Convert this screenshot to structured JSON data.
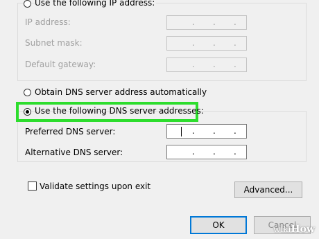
{
  "ip_section": {
    "radio_label": "Use the following IP address:",
    "fields": [
      {
        "label": "IP address:",
        "value": ". . ."
      },
      {
        "label": "Subnet mask:",
        "value": ". . ."
      },
      {
        "label": "Default gateway:",
        "value": ". . ."
      }
    ]
  },
  "dns_section": {
    "auto_label": "Obtain DNS server address automatically",
    "manual_label": "Use the following DNS server addresses:",
    "fields": [
      {
        "label": "Preferred DNS server:"
      },
      {
        "label": "Alternative DNS server:"
      }
    ]
  },
  "validate_label": "Validate settings upon exit",
  "buttons": {
    "advanced": "Advanced...",
    "ok": "OK",
    "cancel": "Cancel"
  },
  "watermark": {
    "part1": "wiki",
    "part2": "How"
  },
  "colors": {
    "highlight": "#2ddd2d",
    "accent": "#0078d7",
    "background": "#f0f0f0"
  }
}
